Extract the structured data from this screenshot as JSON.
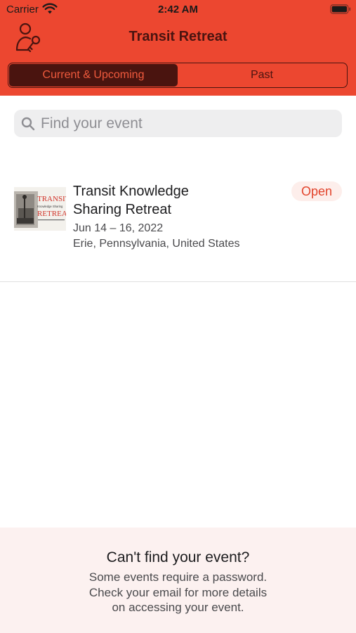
{
  "status_bar": {
    "carrier": "Carrier",
    "time": "2:42 AM"
  },
  "nav": {
    "title": "Transit Retreat",
    "icon": "user-key-icon"
  },
  "segments": [
    {
      "label": "Current & Upcoming",
      "selected": true
    },
    {
      "label": "Past",
      "selected": false
    }
  ],
  "search": {
    "placeholder": "Find your event",
    "value": ""
  },
  "events": [
    {
      "title_line1": "Transit Knowledge",
      "title_line2": "Sharing Retreat",
      "date": "Jun 14 – 16, 2022",
      "location": "Erie, Pennsylvania, United States",
      "status": "Open",
      "thumbnail": {
        "line1": "TRANSIT",
        "line2": "Knowledge Sharing",
        "line3": "RETREAT"
      }
    }
  ],
  "footer": {
    "title": "Can't find your event?",
    "message_lines": [
      "Some events require a password.",
      "Check your email for more details",
      "on accessing your event."
    ]
  },
  "colors": {
    "brand": "#ec4730",
    "brand_dark": "#4a140f",
    "badge_bg": "#fdeeeb",
    "footer_bg": "#fcf1f0"
  }
}
